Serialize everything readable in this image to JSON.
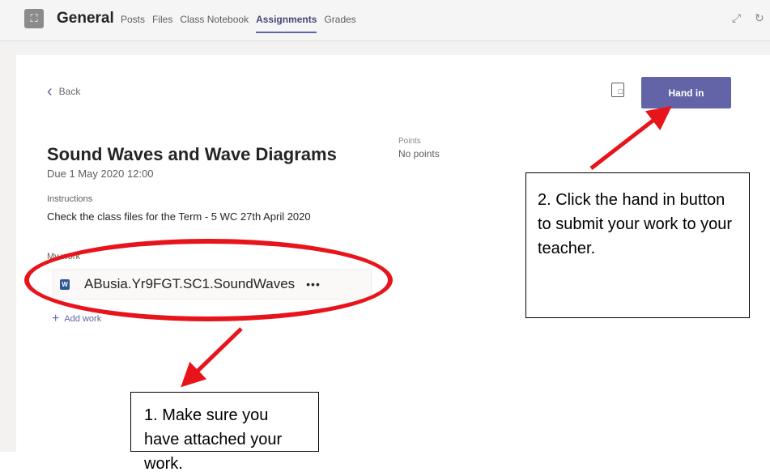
{
  "header": {
    "channel_name": "General",
    "tabs": [
      {
        "label": "Posts",
        "active": false
      },
      {
        "label": "Files",
        "active": false
      },
      {
        "label": "Class Notebook",
        "active": false
      },
      {
        "label": "Assignments",
        "active": true
      },
      {
        "label": "Grades",
        "active": false
      }
    ],
    "icons": [
      "team-icon",
      "expand-icon",
      "refresh-icon"
    ]
  },
  "nav": {
    "back_label": "Back"
  },
  "toolbar": {
    "hand_in_label": "Hand in",
    "doc_icon": "document-preview-icon"
  },
  "assignment": {
    "title": "Sound Waves and Wave Diagrams",
    "due": "Due 1 May 2020 12:00",
    "points_label": "Points",
    "points_value": "No points",
    "instructions_label": "Instructions",
    "instructions_text": "Check the class files for the Term - 5 WC 27th April 2020",
    "my_work_label": "My work",
    "file_name": "ABusia.Yr9FGT.SC1.SoundWaves",
    "file_more": "•••",
    "add_work_label": "Add work"
  },
  "annotations": {
    "callout_1": "2. Click the hand in button to submit your work to your teacher.",
    "callout_2": "1. Make sure you have attached your work.",
    "highlight_color": "#e8141b"
  },
  "colors": {
    "accent": "#6264a7",
    "annotation_red": "#e8141b"
  }
}
